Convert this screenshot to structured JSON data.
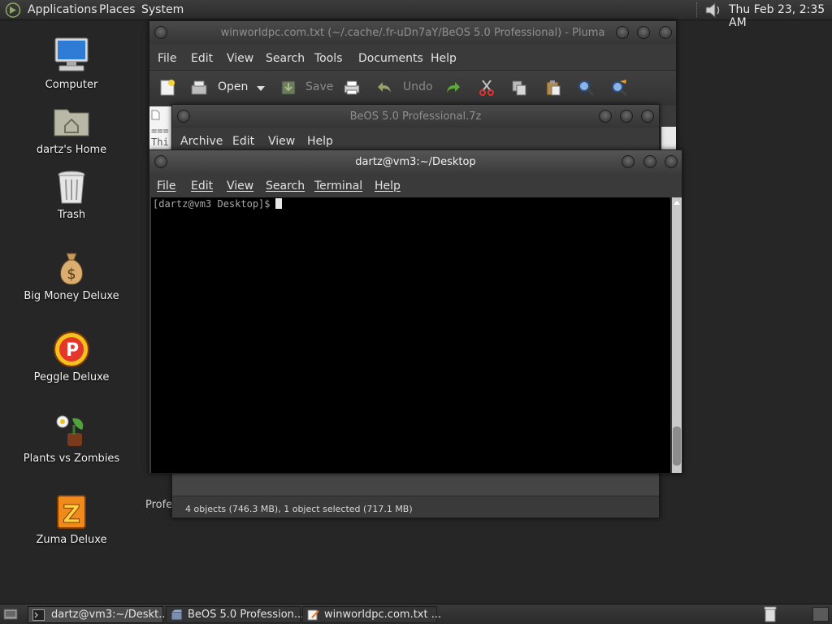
{
  "top_panel": {
    "menus": [
      "Applications",
      "Places",
      "System"
    ],
    "clock": "Thu Feb 23,  2:35 AM"
  },
  "desktop": {
    "icons": [
      {
        "label": "Computer",
        "icon": "computer-icon"
      },
      {
        "label": "dartz's Home",
        "icon": "home-folder-icon"
      },
      {
        "label": "Trash",
        "icon": "trash-icon"
      },
      {
        "label": "Big Money Deluxe",
        "icon": "money-bag-icon"
      },
      {
        "label": "Peggle Deluxe",
        "icon": "peggle-icon"
      },
      {
        "label": "Plants vs Zombies",
        "icon": "plants-icon"
      },
      {
        "label": "Zuma Deluxe",
        "icon": "zuma-icon"
      }
    ],
    "partial_text": "Profe"
  },
  "pluma": {
    "title": "winworldpc.com.txt (~/.cache/.fr-uDn7aY/BeOS 5.0 Professional) - Pluma",
    "menus": [
      "File",
      "Edit",
      "View",
      "Search",
      "Tools",
      "Documents",
      "Help"
    ],
    "toolbar": {
      "open": "Open",
      "save": "Save",
      "undo": "Undo"
    },
    "text_fragments": [
      "===",
      "Thi"
    ]
  },
  "archive": {
    "title": "BeOS 5.0 Professional.7z",
    "menus": [
      "Archive",
      "Edit",
      "View",
      "Help"
    ],
    "status": "4 objects (746.3 MB), 1 object selected (717.1 MB)"
  },
  "terminal": {
    "title": "dartz@vm3:~/Desktop",
    "menus": [
      "File",
      "Edit",
      "View",
      "Search",
      "Terminal",
      "Help"
    ],
    "prompt": "[dartz@vm3 Desktop]$"
  },
  "taskbar": {
    "tasks": [
      {
        "label": "dartz@vm3:~/Deskt...",
        "active": true
      },
      {
        "label": "BeOS 5.0 Profession...",
        "active": false
      },
      {
        "label": "winworldpc.com.txt ...",
        "active": false
      }
    ]
  },
  "colors": {
    "desktop_bg": "#262626",
    "terminal_bg": "#000000",
    "panel": "#333333"
  }
}
